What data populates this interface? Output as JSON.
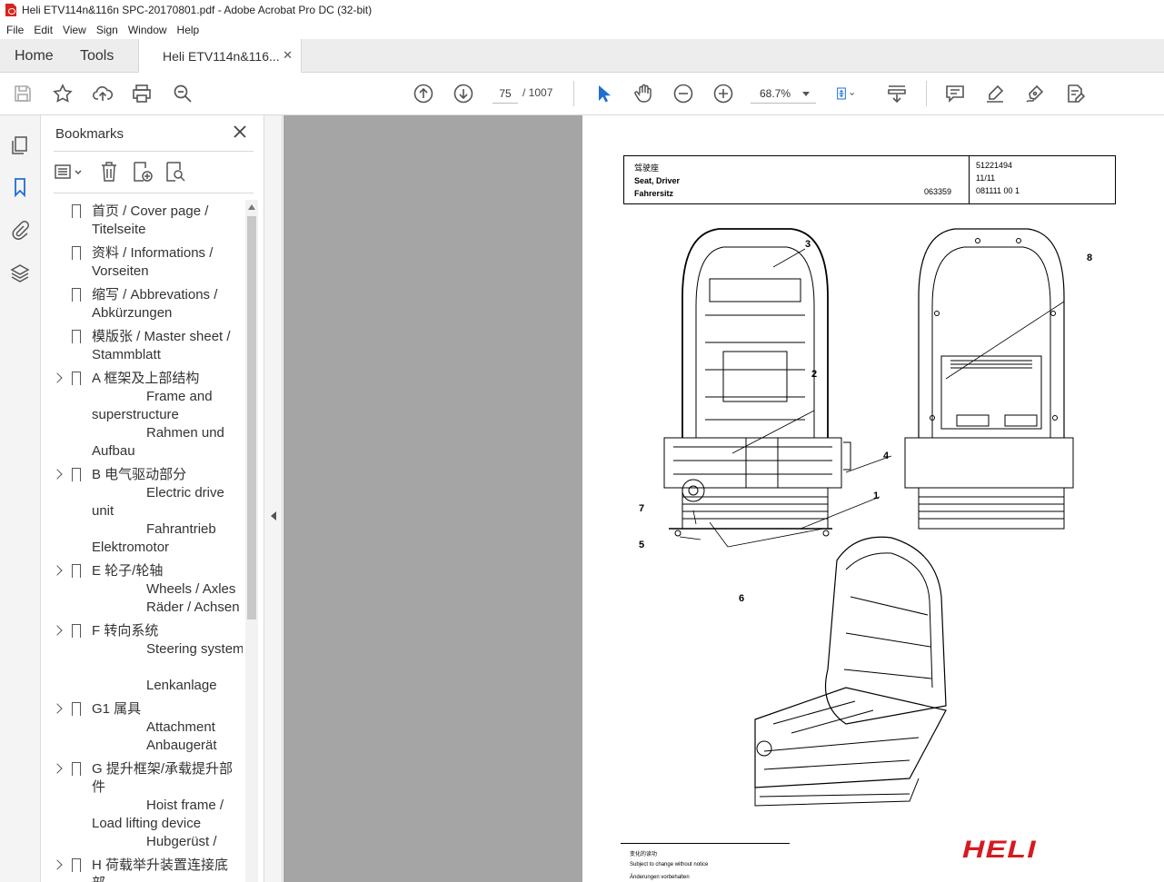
{
  "window": {
    "title": "Heli ETV114n&116n SPC-20170801.pdf - Adobe Acrobat Pro DC (32-bit)"
  },
  "menu": [
    "File",
    "Edit",
    "View",
    "Sign",
    "Window",
    "Help"
  ],
  "tabs": {
    "home": "Home",
    "tools": "Tools",
    "document": "Heli ETV114n&116..."
  },
  "toolbar": {
    "page_current": "75",
    "page_total": "/ 1007",
    "zoom": "68.7%"
  },
  "bookmarks": {
    "title": "Bookmarks",
    "items": [
      {
        "expandable": false,
        "lines": [
          "首页 / Cover page /",
          "Titelseite"
        ]
      },
      {
        "expandable": false,
        "lines": [
          "资料 / Informations /",
          "Vorseiten"
        ]
      },
      {
        "expandable": false,
        "lines": [
          "缩写 / Abbrevations /",
          "Abkürzungen"
        ]
      },
      {
        "expandable": false,
        "lines": [
          "模版张 / Master sheet /",
          "Stammblatt"
        ]
      },
      {
        "expandable": true,
        "lines": [
          "A 框架及上部结构",
          "Frame and",
          "superstructure",
          "Rahmen und",
          "Aufbau"
        ]
      },
      {
        "expandable": true,
        "lines": [
          "B 电气驱动部分",
          "Electric drive",
          "unit",
          "Fahrantrieb",
          "Elektromotor"
        ]
      },
      {
        "expandable": true,
        "lines": [
          "E 轮子/轮轴",
          "Wheels / Axles",
          "Räder / Achsen"
        ]
      },
      {
        "expandable": true,
        "lines": [
          "F 转向系统",
          "Steering system",
          "",
          "Lenkanlage"
        ]
      },
      {
        "expandable": true,
        "lines": [
          "G1 属具",
          "Attachment",
          "Anbaugerät"
        ]
      },
      {
        "expandable": true,
        "lines": [
          "G 提升框架/承载提升部",
          "件",
          "Hoist frame /",
          "Load lifting device",
          "Hubgerüst /"
        ]
      },
      {
        "expandable": true,
        "lines": [
          "H 荷载举升装置连接底",
          "部"
        ]
      }
    ]
  },
  "document_page": {
    "header": {
      "title_cn": "驾驶座",
      "title_en": "Seat, Driver",
      "title_de": "Fahrersitz",
      "drawing_no": "063359",
      "part_no": "51221494",
      "date": "11/11",
      "code": "081111 00 1"
    },
    "callouts": [
      "1",
      "2",
      "3",
      "4",
      "5",
      "6",
      "7",
      "8"
    ],
    "footer": {
      "line_cn": "变化的读功",
      "line_en": "Subject to change without notice",
      "line_de": "Änderungen vorbehalten"
    },
    "logo": "HELI"
  },
  "colors": {
    "brand_red": "#d71920",
    "doc_background": "#a5a5a5",
    "pdf_icon": "#d9241c"
  }
}
